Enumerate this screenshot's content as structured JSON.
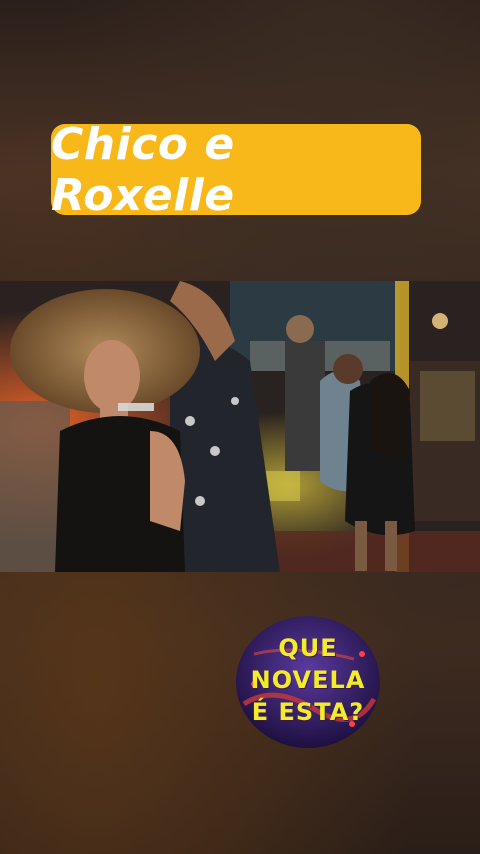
{
  "title": {
    "text": "Chico e Roxelle"
  },
  "logo": {
    "lines": [
      "QUE",
      "NOVELA",
      "É ESTA?"
    ]
  },
  "icons": {
    "watermark": "broadcaster-logo-icon"
  },
  "colors": {
    "banner": "#f9b81a",
    "logo_text": "#f3ec2a",
    "logo_bg": "#3a1f6e"
  }
}
